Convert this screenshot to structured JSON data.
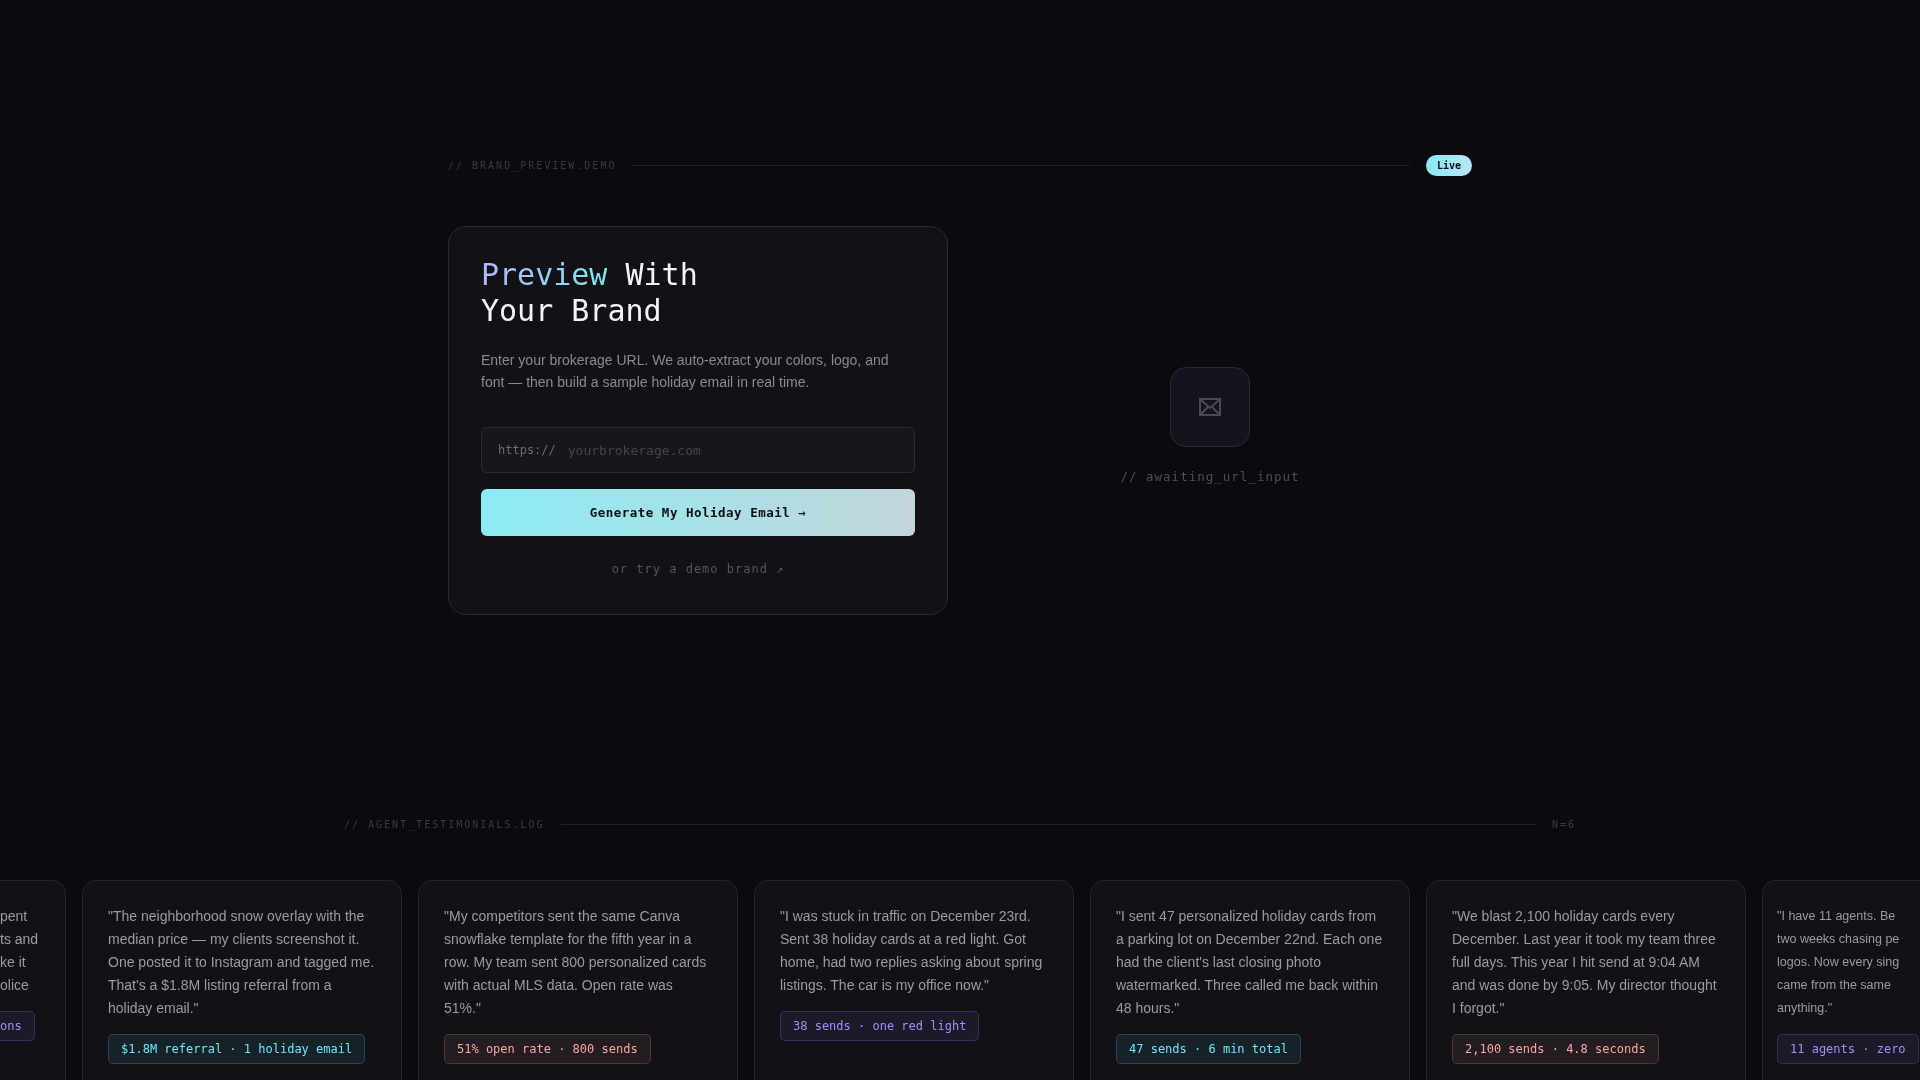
{
  "preview_header": {
    "label": "// BRAND_PREVIEW.DEMO",
    "badge": "Live"
  },
  "form_card": {
    "title_highlight": "Preview",
    "title_rest": "With Your Brand",
    "description": "Enter your brokerage URL. We auto-extract your colors, logo, and font — then build a sample holiday email in real time.",
    "url_prefix": "https://",
    "url_placeholder": "yourbrokerage.com",
    "button": "Generate My Holiday Email →",
    "demo_link": "or try a demo brand ↗"
  },
  "preview_pane": {
    "status": "// awaiting_url_input"
  },
  "testimonials_header": {
    "label": "// AGENT_TESTIMONIALS.LOG",
    "count": "N=6"
  },
  "testimonials": [
    {
      "kind": "partial_left",
      "lines": [
        "pent",
        "ts and",
        "ke it",
        "olice"
      ],
      "tag": {
        "text": "ons",
        "color": "#a78bfa"
      }
    },
    {
      "kind": "full",
      "quote": "\"The neighborhood snow overlay with the median price — my clients screenshot it. One posted it to Instagram and tagged me. That's a $1.8M listing referral from a holiday email.\"",
      "tag": {
        "text": "$1.8M referral · 1 holiday email",
        "color": "#67e8f9"
      }
    },
    {
      "kind": "full",
      "quote": "\"My competitors sent the same Canva snowflake template for the fifth year in a row. My team sent 800 personalized cards with actual MLS data. Open rate was 51%.\"",
      "tag": {
        "text": "51% open rate · 800 sends",
        "color": "#fca5a5"
      }
    },
    {
      "kind": "full",
      "quote": "\"I was stuck in traffic on December 23rd. Sent 38 holiday cards at a red light. Got home, had two replies asking about spring listings. The car is my office now.\"",
      "tag": {
        "text": "38 sends · one red light",
        "color": "#a78bfa"
      }
    },
    {
      "kind": "full",
      "quote": "\"I sent 47 personalized holiday cards from a parking lot on December 22nd. Each one had the client's last closing photo watermarked. Three called me back within 48 hours.\"",
      "tag": {
        "text": "47 sends · 6 min total",
        "color": "#67e8f9"
      }
    },
    {
      "kind": "full",
      "quote": "\"We blast 2,100 holiday cards every December. Last year it took my team three full days. This year I hit send at 9:04 AM and was done by 9:05. My director thought I forgot.\"",
      "tag": {
        "text": "2,100 sends · 4.8 seconds",
        "color": "#fca5a5"
      }
    },
    {
      "kind": "partial_right",
      "lines": [
        "\"I have 11 agents. Be",
        "two weeks chasing pe",
        "logos. Now every sing",
        "came from the same",
        "anything.\""
      ],
      "tag": {
        "text": "11 agents · zero",
        "color": "#a78bfa"
      }
    }
  ]
}
